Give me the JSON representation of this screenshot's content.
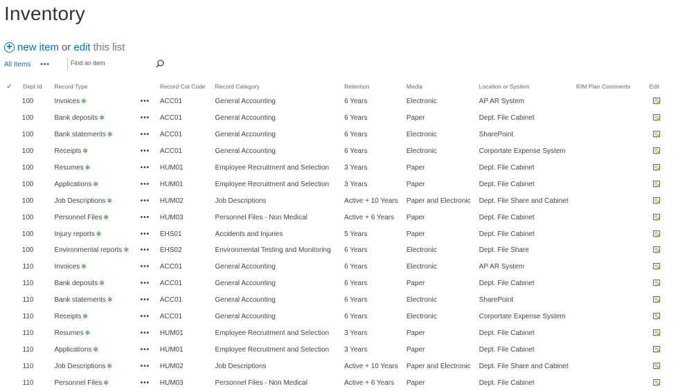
{
  "page": {
    "title": "Inventory"
  },
  "toolbar": {
    "new_item": "new item",
    "or": "or",
    "edit": "edit",
    "this_list": "this list"
  },
  "views": {
    "current": "All Items",
    "more": "•••"
  },
  "search": {
    "placeholder": "Find an item"
  },
  "columns": {
    "check": "✓",
    "dept": "Dept.Id",
    "type": "Record Type",
    "code": "Record Cat Code",
    "category": "Record Category",
    "retention": "Retention",
    "media": "Media",
    "location": "Location or System",
    "rim": "RIM Plan Comments",
    "edit": "Edit"
  },
  "new_flag": "✻",
  "row_menu": "•••",
  "rows": [
    {
      "dept": "100",
      "type": "Invoices",
      "code": "ACC01",
      "category": "General Accounting",
      "retention": "6 Years",
      "media": "Electronic",
      "location": "AP AR System"
    },
    {
      "dept": "100",
      "type": "Bank deposits",
      "code": "ACC01",
      "category": "General Accounting",
      "retention": "6 Years",
      "media": "Paper",
      "location": "Dept. File Cabinet"
    },
    {
      "dept": "100",
      "type": "Bank statements",
      "code": "ACC01",
      "category": "General Accounting",
      "retention": "6 Years",
      "media": "Electronic",
      "location": "SharePoint"
    },
    {
      "dept": "100",
      "type": "Receipts",
      "code": "ACC01",
      "category": "General Accounting",
      "retention": "6 Years",
      "media": "Electronic",
      "location": "Corportate Expense System"
    },
    {
      "dept": "100",
      "type": "Resumes",
      "code": "HUM01",
      "category": "Employee Recruitment and Selection",
      "retention": "3 Years",
      "media": "Paper",
      "location": "Dept. File Cabinet"
    },
    {
      "dept": "100",
      "type": "Applications",
      "code": "HUM01",
      "category": "Employee Recruitment and Selection",
      "retention": "3 Years",
      "media": "Paper",
      "location": "Dept. File Cabinet"
    },
    {
      "dept": "100",
      "type": "Job Descriptions",
      "code": "HUM02",
      "category": "Job Descriptions",
      "retention": "Active + 10 Years",
      "media": "Paper and Electronic",
      "location": "Dept. File Share and Cabinet"
    },
    {
      "dept": "100",
      "type": "Personnel Files",
      "code": "HUM03",
      "category": "Personnel Files - Non Medical",
      "retention": "Active + 6 Years",
      "media": "Paper",
      "location": "Dept. File Cabinet"
    },
    {
      "dept": "100",
      "type": "Injury reports",
      "code": "EHS01",
      "category": "Accidents and Injuries",
      "retention": "5 Years",
      "media": "Paper",
      "location": "Dept. File Cabinet"
    },
    {
      "dept": "100",
      "type": "Environmental reports",
      "code": "EHS02",
      "category": "Environmental Testing and Monitoring",
      "retention": "6 Years",
      "media": "Electronic",
      "location": "Dept. File Share"
    },
    {
      "dept": "110",
      "type": "Invoices",
      "code": "ACC01",
      "category": "General Accounting",
      "retention": "6 Years",
      "media": "Electronic",
      "location": "AP AR System"
    },
    {
      "dept": "110",
      "type": "Bank deposits",
      "code": "ACC01",
      "category": "General Accounting",
      "retention": "6 Years",
      "media": "Paper",
      "location": "Dept. File Cabinet"
    },
    {
      "dept": "110",
      "type": "Bank statements",
      "code": "ACC01",
      "category": "General Accounting",
      "retention": "6 Years",
      "media": "Electronic",
      "location": "SharePoint"
    },
    {
      "dept": "110",
      "type": "Receipts",
      "code": "ACC01",
      "category": "General Accounting",
      "retention": "6 Years",
      "media": "Electronic",
      "location": "Corportate Expense System"
    },
    {
      "dept": "110",
      "type": "Resumes",
      "code": "HUM01",
      "category": "Employee Recruitment and Selection",
      "retention": "3 Years",
      "media": "Paper",
      "location": "Dept. File Cabinet"
    },
    {
      "dept": "110",
      "type": "Applications",
      "code": "HUM01",
      "category": "Employee Recruitment and Selection",
      "retention": "3 Years",
      "media": "Paper",
      "location": "Dept. File Cabinet"
    },
    {
      "dept": "110",
      "type": "Job Descriptions",
      "code": "HUM02",
      "category": "Job Descriptions",
      "retention": "Active + 10 Years",
      "media": "Paper and Electronic",
      "location": "Dept. File Share and Cabinet"
    },
    {
      "dept": "110",
      "type": "Personnel Files",
      "code": "HUM03",
      "category": "Personnel Files - Non Medical",
      "retention": "Active + 6 Years",
      "media": "Paper",
      "location": "Dept. File Cabinet"
    }
  ],
  "colors": {
    "accent": "#0072c6",
    "new_flag": "#2d8b2d",
    "text": "#444444"
  }
}
